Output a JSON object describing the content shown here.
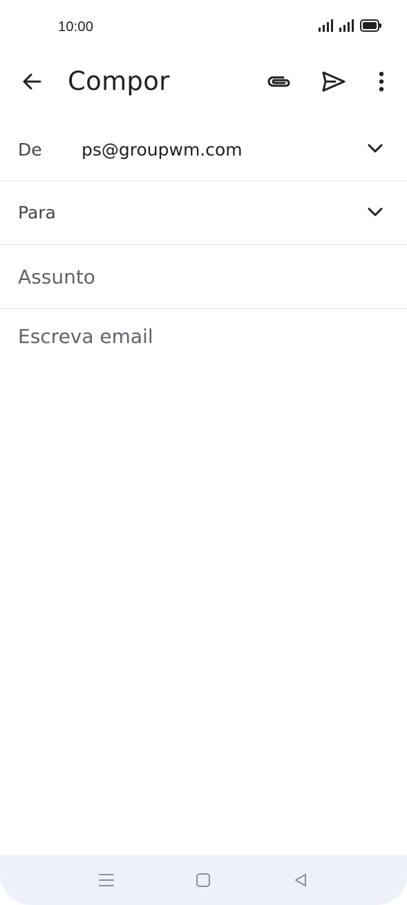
{
  "status_bar": {
    "time": "10:00",
    "icons": [
      "signal-icon",
      "signal-icon",
      "battery-icon"
    ]
  },
  "toolbar": {
    "title": "Compor",
    "back_icon": "arrow-back-icon",
    "attach_icon": "paperclip-icon",
    "send_icon": "send-icon",
    "more_icon": "more-vert-icon"
  },
  "compose": {
    "from_label": "De",
    "from_value": "ps@groupwm.com",
    "to_label": "Para",
    "subject_placeholder": "Assunto",
    "body_placeholder": "Escreva email"
  },
  "nav_bar": {
    "icons": [
      "menu-icon",
      "home-icon",
      "back-icon"
    ]
  },
  "colors": {
    "background": "#ffffff",
    "text_primary": "#1f1f1f",
    "text_secondary": "#444746",
    "placeholder": "#5f6368",
    "divider": "#e3e3e3",
    "nav_bar_bg": "#edf1f9"
  }
}
